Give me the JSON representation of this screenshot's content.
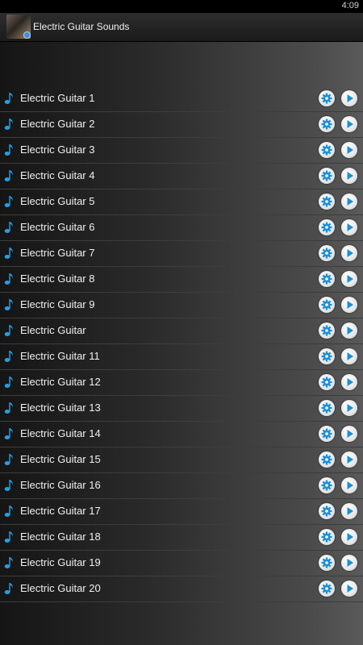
{
  "status_bar": {
    "time": "4:09"
  },
  "action_bar": {
    "title": "Electric Guitar Sounds",
    "app_icon": "guitar-app-icon"
  },
  "icons": {
    "row_icon": "music-note-icon",
    "settings": "gear-icon",
    "play": "play-icon"
  },
  "colors": {
    "accent": "#1a8fd8",
    "note": "#2a9be0"
  },
  "sounds": [
    {
      "label": "Electric Guitar 1"
    },
    {
      "label": "Electric Guitar 2"
    },
    {
      "label": "Electric Guitar 3"
    },
    {
      "label": "Electric Guitar 4"
    },
    {
      "label": "Electric Guitar 5"
    },
    {
      "label": "Electric Guitar 6"
    },
    {
      "label": "Electric Guitar 7"
    },
    {
      "label": "Electric Guitar 8"
    },
    {
      "label": "Electric Guitar 9"
    },
    {
      "label": "Electric Guitar"
    },
    {
      "label": "Electric Guitar 11"
    },
    {
      "label": "Electric Guitar 12"
    },
    {
      "label": "Electric Guitar 13"
    },
    {
      "label": "Electric Guitar 14"
    },
    {
      "label": "Electric Guitar 15"
    },
    {
      "label": "Electric Guitar 16"
    },
    {
      "label": "Electric Guitar 17"
    },
    {
      "label": "Electric Guitar 18"
    },
    {
      "label": "Electric Guitar 19"
    },
    {
      "label": "Electric Guitar 20"
    }
  ]
}
